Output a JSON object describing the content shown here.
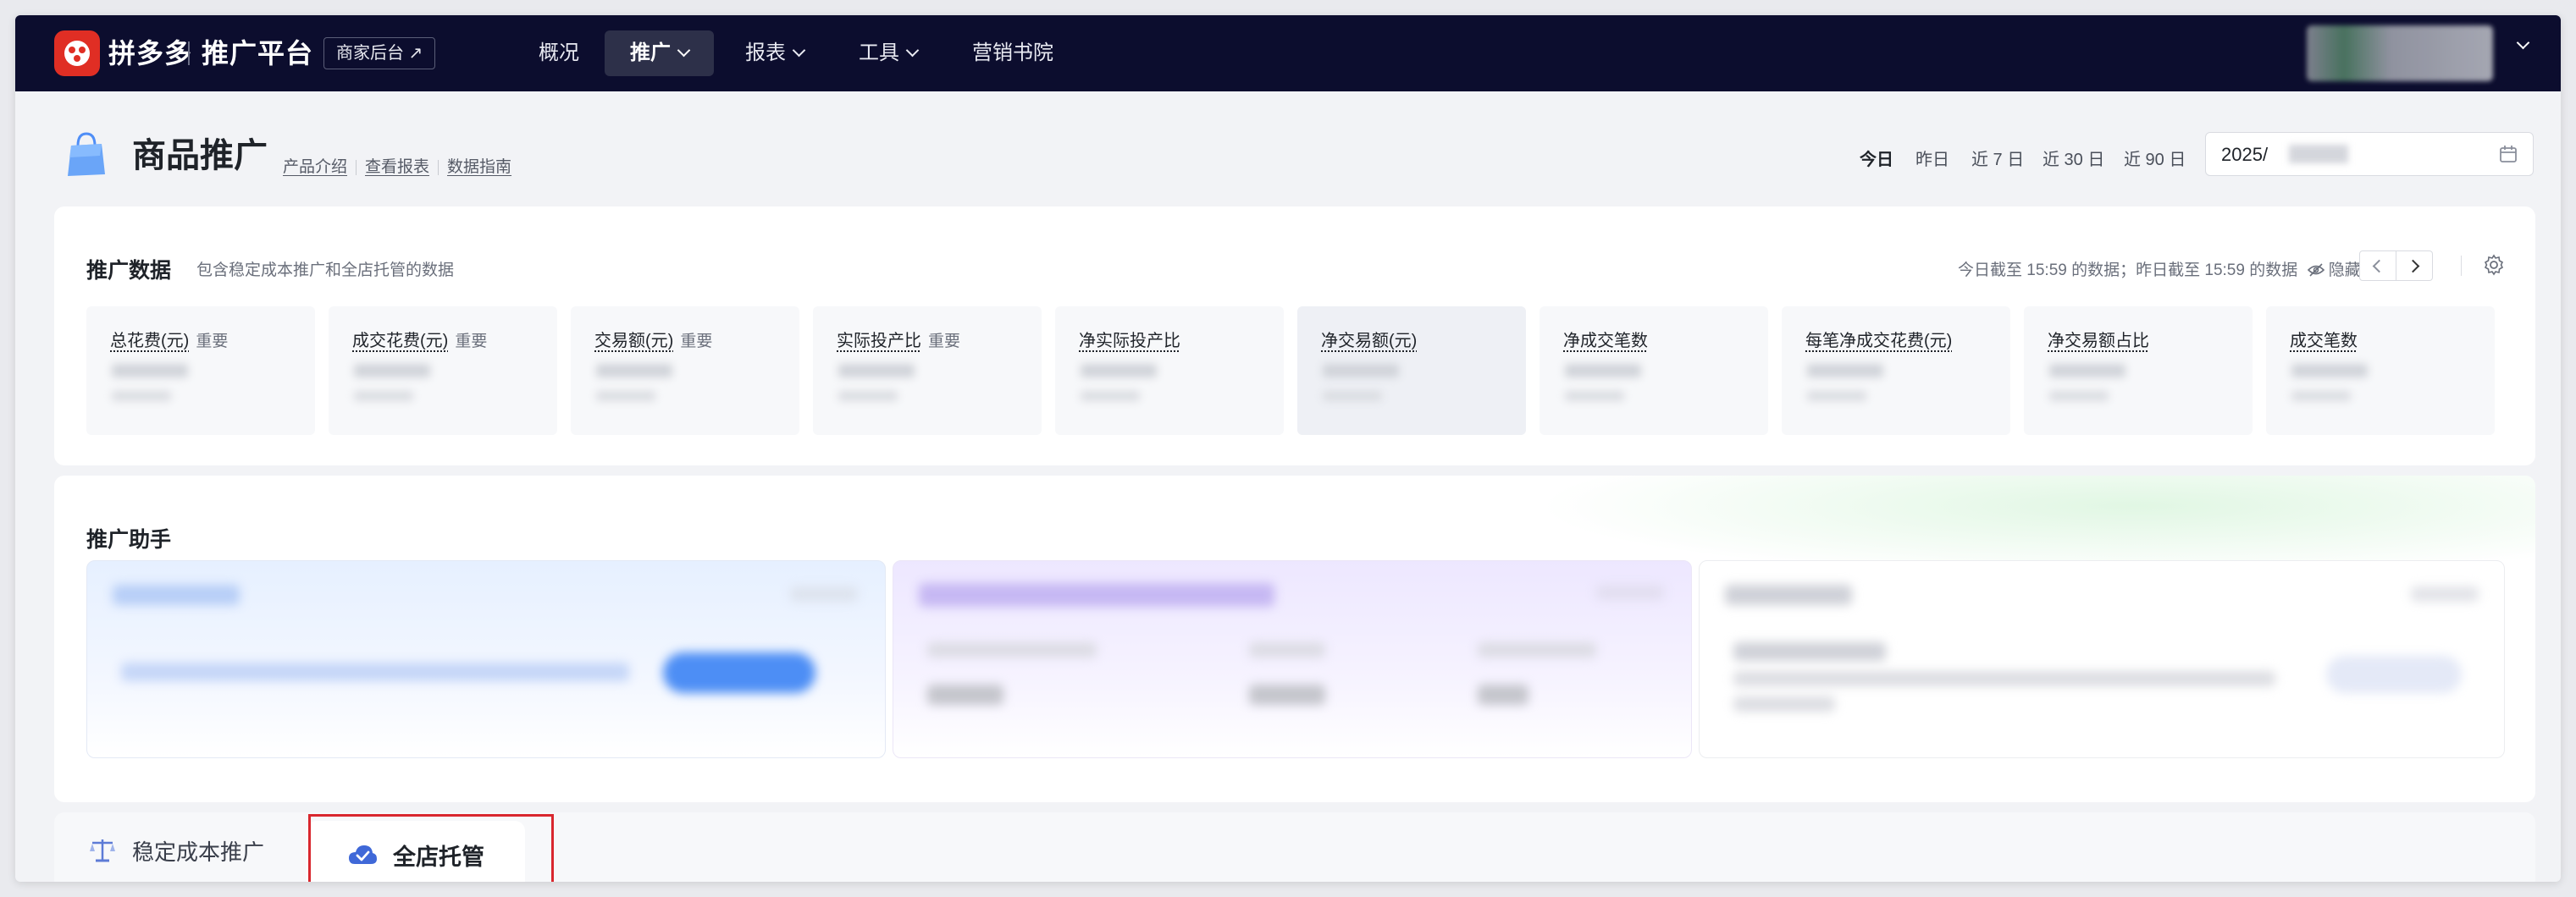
{
  "nav": {
    "brand": "拼多多",
    "platform": "推广平台",
    "merchant_link": "商家后台 ↗",
    "items": [
      {
        "label": "概况",
        "dropdown": false,
        "active": false
      },
      {
        "label": "推广",
        "dropdown": true,
        "active": true
      },
      {
        "label": "报表",
        "dropdown": true,
        "active": false
      },
      {
        "label": "工具",
        "dropdown": true,
        "active": false
      },
      {
        "label": "营销书院",
        "dropdown": false,
        "active": false
      }
    ]
  },
  "header": {
    "title": "商品推广",
    "links": [
      "产品介绍",
      "查看报表",
      "数据指南"
    ],
    "date_tabs": [
      "今日",
      "昨日",
      "近 7 日",
      "近 30 日",
      "近 90 日"
    ],
    "active_date_tab": "今日",
    "date_value": "2025/"
  },
  "data_card": {
    "title": "推广数据",
    "desc": "包含稳定成本推广和全店托管的数据",
    "notice": "今日截至 15:59 的数据；昨日截至 15:59 的数据",
    "hide_label": "隐藏",
    "metrics": [
      {
        "label": "总花费(元)",
        "tag": "重要"
      },
      {
        "label": "成交花费(元)",
        "tag": "重要"
      },
      {
        "label": "交易额(元)",
        "tag": "重要"
      },
      {
        "label": "实际投产比",
        "tag": "重要"
      },
      {
        "label": "净实际投产比",
        "tag": ""
      },
      {
        "label": "净交易额(元)",
        "tag": ""
      },
      {
        "label": "净成交笔数",
        "tag": ""
      },
      {
        "label": "每笔净成交花费(元)",
        "tag": ""
      },
      {
        "label": "净交易额占比",
        "tag": ""
      },
      {
        "label": "成交笔数",
        "tag": ""
      }
    ]
  },
  "assistant_card": {
    "title": "推广助手"
  },
  "tabs": [
    {
      "label": "稳定成本推广",
      "active": false
    },
    {
      "label": "全店托管",
      "active": true
    }
  ],
  "colors": {
    "nav_bg": "#0c0d2e",
    "brand_red": "#e02e24",
    "highlight_border": "#d9272e"
  }
}
